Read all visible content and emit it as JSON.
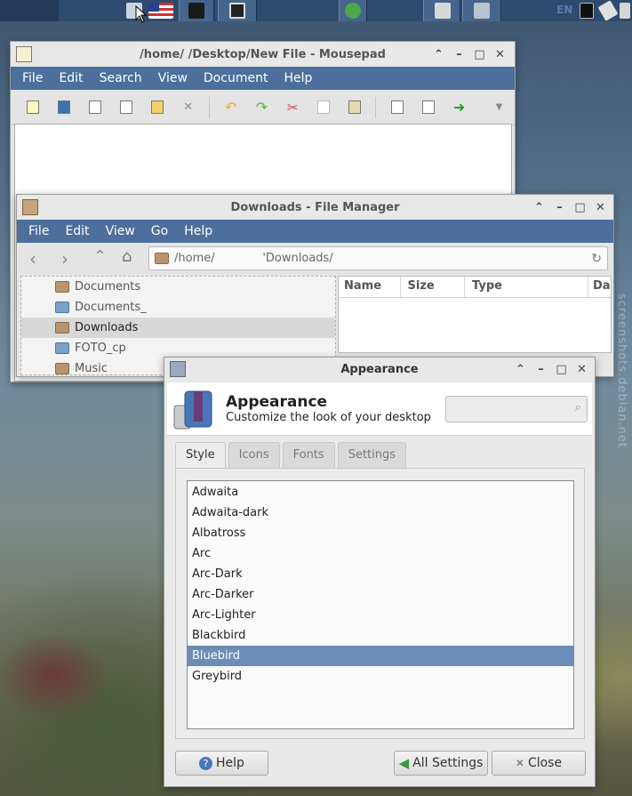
{
  "panel": {
    "keyboard_layout": "EN",
    "watermark": "screenshots.debian.net"
  },
  "mousepad": {
    "title": "/home/          /Desktop/New File - Mousepad",
    "menu": [
      "File",
      "Edit",
      "Search",
      "View",
      "Document",
      "Help"
    ]
  },
  "filemanager": {
    "title": "Downloads - File Manager",
    "menu": [
      "File",
      "Edit",
      "View",
      "Go",
      "Help"
    ],
    "location": "/home/             'Downloads/",
    "columns": [
      "Name",
      "Size",
      "Type",
      "Da"
    ],
    "tree": [
      {
        "label": "Documents",
        "color": "brown"
      },
      {
        "label": "Documents_",
        "color": "blue"
      },
      {
        "label": "Downloads",
        "color": "brown",
        "selected": true
      },
      {
        "label": "FOTO_cp",
        "color": "blue"
      },
      {
        "label": "Music",
        "color": "brown"
      }
    ]
  },
  "appearance": {
    "window_title": "Appearance",
    "heading": "Appearance",
    "subheading": "Customize the look of your desktop",
    "search_placeholder": "",
    "tabs": [
      "Style",
      "Icons",
      "Fonts",
      "Settings"
    ],
    "active_tab": "Style",
    "themes": [
      "Adwaita",
      "Adwaita-dark",
      "Albatross",
      "Arc",
      "Arc-Dark",
      "Arc-Darker",
      "Arc-Lighter",
      "Blackbird",
      "Bluebird",
      "Greybird"
    ],
    "selected_theme": "Bluebird",
    "help_label": "Help",
    "all_settings_label": "All Settings",
    "close_label": "Close"
  },
  "colors": {
    "panel": "#2e4a6e",
    "menubar": "#4c6f9b",
    "selection": "#6c8db5"
  }
}
